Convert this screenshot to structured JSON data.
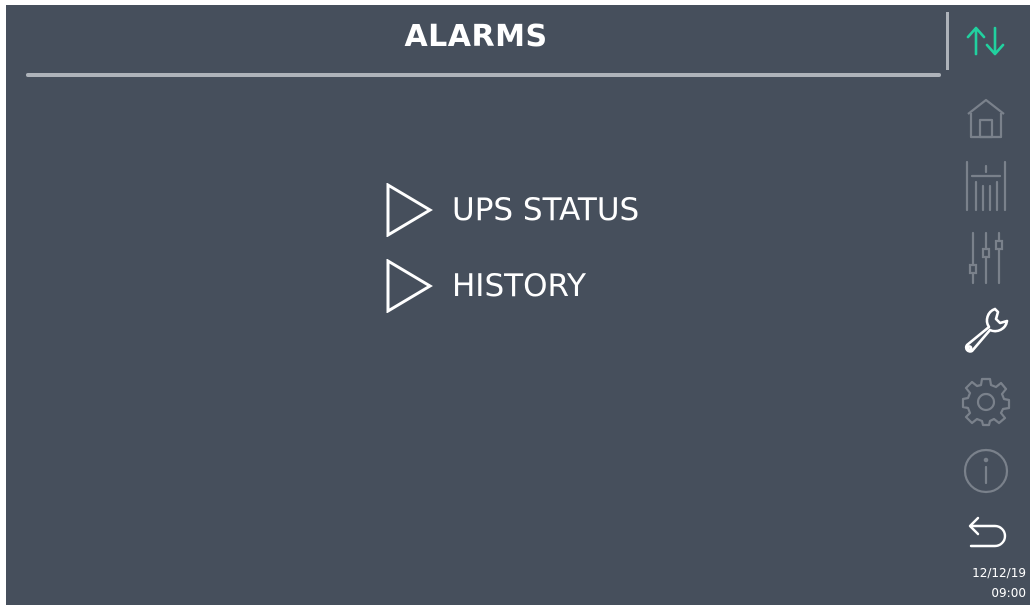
{
  "header": {
    "title": "ALARMS"
  },
  "menu": {
    "items": [
      {
        "label": "UPS STATUS",
        "icon": "play-triangle-icon"
      },
      {
        "label": "HISTORY",
        "icon": "play-triangle-icon"
      }
    ]
  },
  "sidebar": {
    "icons": [
      {
        "name": "communication-arrows-icon",
        "active": true
      },
      {
        "name": "home-icon",
        "active": false
      },
      {
        "name": "measurements-icon",
        "active": false
      },
      {
        "name": "settings-sliders-icon",
        "active": false
      },
      {
        "name": "wrench-icon",
        "active": true
      },
      {
        "name": "gear-icon",
        "active": false
      },
      {
        "name": "info-icon",
        "active": false
      },
      {
        "name": "back-arrow-icon",
        "active": false
      }
    ]
  },
  "status": {
    "date": "12/12/19",
    "time": "09:00"
  },
  "colors": {
    "background": "#464f5c",
    "text": "#ffffff",
    "rule": "#aeb3ba",
    "accent": "#21d19f",
    "inactive_icon": "#7a818b"
  }
}
